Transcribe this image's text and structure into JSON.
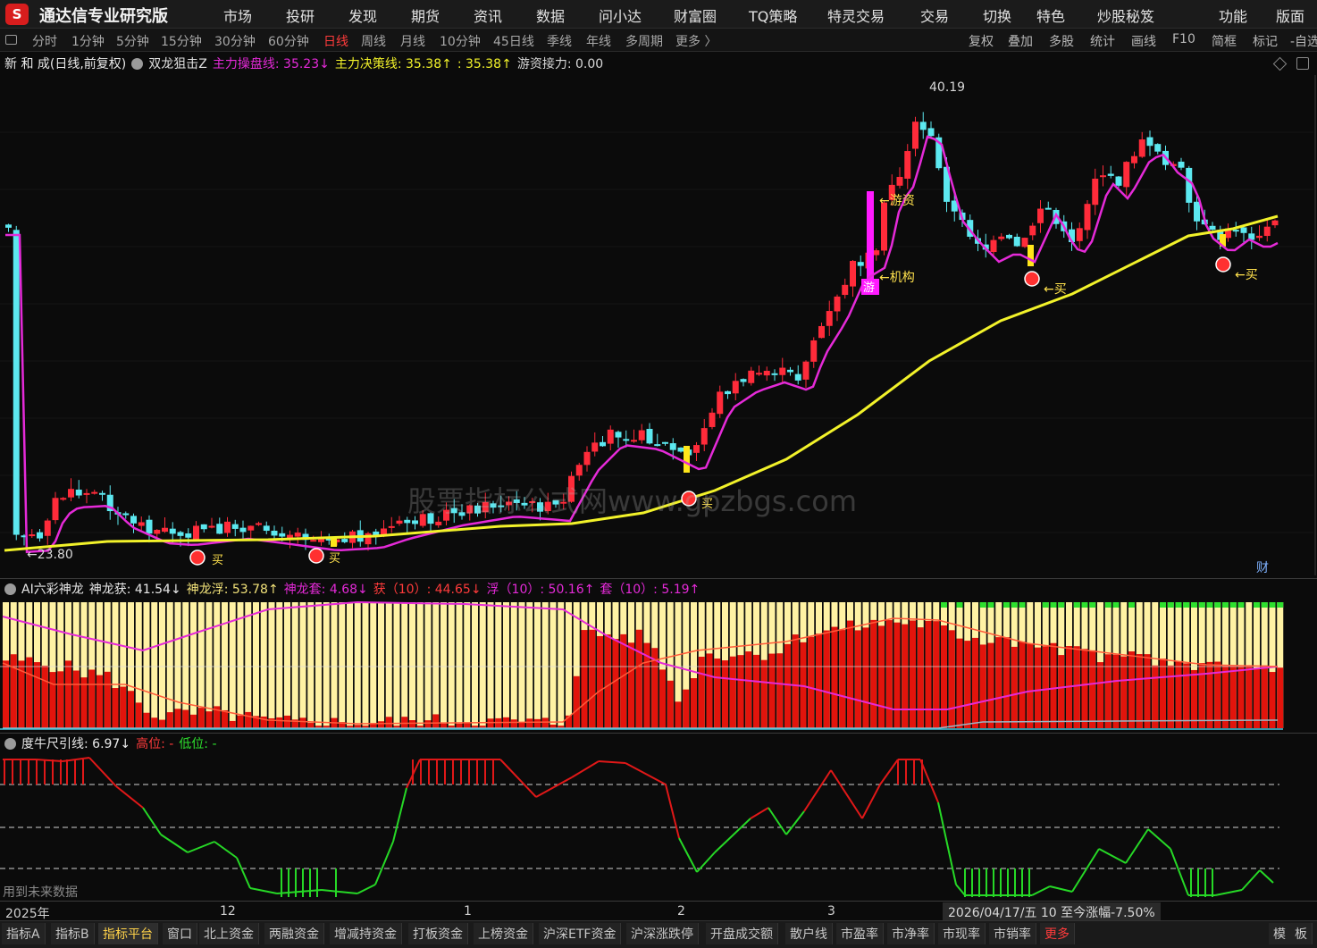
{
  "app": {
    "logo_text": "S",
    "title": "通达信专业研究版"
  },
  "menu": [
    "市场",
    "投研",
    "发现",
    "期货",
    "资讯",
    "数据",
    "问小达",
    "财富圈",
    "TQ策略",
    "特灵交易",
    "交易",
    "切换",
    "特色",
    "炒股秘笈",
    "功能",
    "版面"
  ],
  "periods": [
    "分时",
    "1分钟",
    "5分钟",
    "15分钟",
    "30分钟",
    "60分钟",
    "日线",
    "周线",
    "月线",
    "10分钟",
    "45日线",
    "季线",
    "年线",
    "多周期",
    "更多 〉"
  ],
  "active_period": "日线",
  "tools": [
    "复权",
    "叠加",
    "多股",
    "统计",
    "画线",
    "F10",
    "简框",
    "标记",
    "-自选"
  ],
  "main_header": {
    "stock": "新 和 成(日线,前复权)",
    "indicator": "双龙狙击Z",
    "line1": "主力操盘线: 35.23↓",
    "line2": "主力决策线: 35.38↑",
    "line3": ": 35.38↑",
    "line4": "游资接力: 0.00"
  },
  "main_annotations": {
    "high": "40.19",
    "low": "23.80",
    "youzi": "游资",
    "jigou": "机构",
    "you_badge": "游",
    "buy": "买",
    "cai": "财",
    "watermark": "股票指标公式网www.gpzbgs.com"
  },
  "ind1_header": {
    "name": "AI六彩神龙",
    "v1": "神龙获: 41.54↓",
    "v2": "神龙浮: 53.78↑",
    "v3": "神龙套: 4.68↓",
    "v4": "获（10）: 44.65↓",
    "v5": "浮（10）: 50.16↑",
    "v6": "套（10）: 5.19↑"
  },
  "ind2_header": {
    "name": "度牛尺引线",
    "v1": ": 6.97↓",
    "v2": "高位: -",
    "v3": "低位: -"
  },
  "ind2_note": "用到未来数据",
  "date_axis": {
    "labels": [
      {
        "text": "2025年",
        "key": "y2025"
      },
      {
        "text": "12",
        "key": "m12"
      },
      {
        "text": "1",
        "key": "m1"
      },
      {
        "text": "2",
        "key": "m2"
      },
      {
        "text": "3",
        "key": "m3"
      }
    ],
    "info": "2026/04/17/五  10 至今涨幅-7.50%"
  },
  "tabs": [
    "指标A",
    "指标B",
    "指标平台",
    "窗口",
    "北上资金",
    "两融资金",
    "增减持资金",
    "打板资金",
    "上榜资金",
    "沪深ETF资金",
    "沪深涨跌停",
    "开盘成交额",
    "散户线",
    "市盈率",
    "市净率",
    "市现率",
    "市销率",
    "更多"
  ],
  "tabs_right": [
    "模",
    "板"
  ],
  "active_tab": "指标平台",
  "colors": {
    "up": "#ff2b3a",
    "down": "#5ce8f0",
    "yellow_line": "#f2f22a",
    "magenta_line": "#e52ad8",
    "cream": "#fff2a4",
    "bar_red": "#e2140c",
    "osc_red": "#e01818",
    "osc_green": "#26d826"
  }
}
